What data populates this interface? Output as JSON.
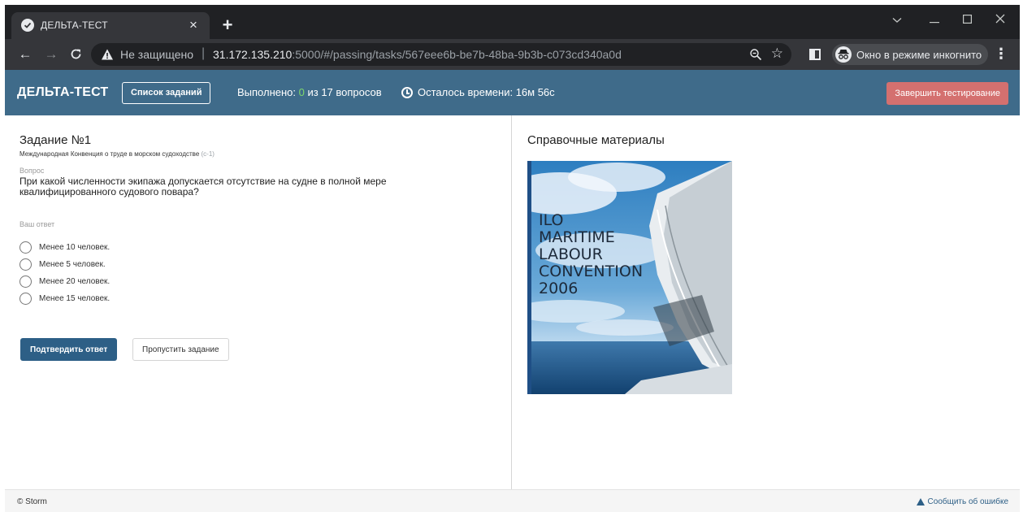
{
  "browser": {
    "tab_title": "ДЕЛЬТА-ТЕСТ",
    "tab_close": "×",
    "new_tab": "+",
    "insecure_label": "Не защищено",
    "url_host": "31.172.135.210",
    "url_rest": ":5000/#/passing/tasks/567eee6b-be7b-48ba-9b3b-c073cd340a0d",
    "incognito_label": "Окно в режиме инкогнито",
    "icons": [
      "shield-check-icon",
      "back-arrow-icon",
      "forward-arrow-icon",
      "reload-icon",
      "warning-icon",
      "zoom-icon",
      "star-icon",
      "side-panel-icon",
      "incognito-icon",
      "menu-dots-icon",
      "minimize-icon",
      "maximize-icon",
      "close-icon",
      "chevron-down-icon"
    ]
  },
  "header": {
    "brand": "ДЕЛЬТА-ТЕСТ",
    "task_list_button": "Список заданий",
    "progress_prefix": "Выполнено: ",
    "progress_done": "0",
    "progress_suffix": " из 17 вопросов",
    "time_label": "Осталось времени: 16м 56с",
    "finish_button": "Завершить тестирование",
    "colors": {
      "header_bg": "#3f6b8a",
      "finish_bg": "#d4706f",
      "done_green": "#7ed96c"
    }
  },
  "task": {
    "title": "Задание №1",
    "subtitle": "Международная Конвенция о труде в морском судоходстве",
    "code": "(с-1)",
    "question_label": "Вопрос",
    "question": "При какой численности экипажа допускается отсутствие на судне в полной мере квалифицированного судового повара?",
    "answer_label": "Ваш ответ",
    "options": [
      "Менее 10 человек.",
      "Менее 5 человек.",
      "Менее 20 человек.",
      "Менее 15 человек."
    ],
    "confirm_button": "Подтвердить ответ",
    "skip_button": "Пропустить задание",
    "colors": {
      "primary": "#2d5f86"
    }
  },
  "reference": {
    "title": "Справочные материалы",
    "cover_lines": [
      "ILO",
      "MARITIME",
      "LABOUR",
      "CONVENTION",
      "2006"
    ]
  },
  "footer": {
    "copyright": "© Storm",
    "report_link": "Сообщить об ошибке"
  }
}
